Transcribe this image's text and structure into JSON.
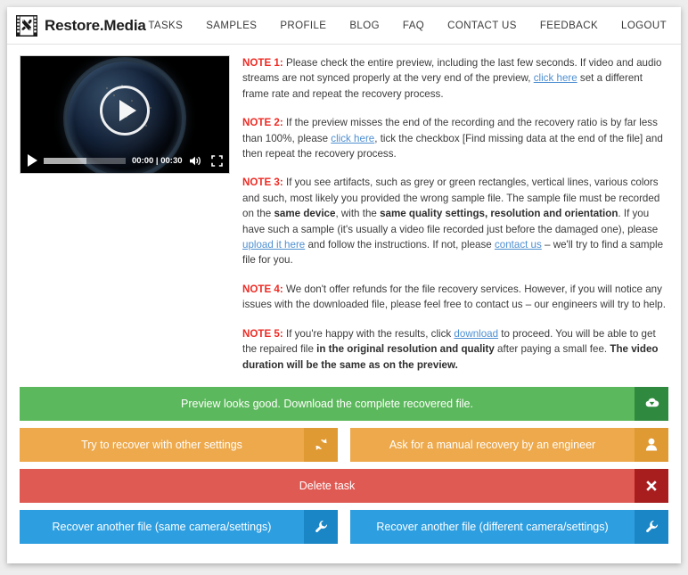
{
  "header": {
    "brand_name": "Restore.Media",
    "brand_icon": "film-strip-tools-icon",
    "nav": [
      {
        "label": "TASKS"
      },
      {
        "label": "SAMPLES"
      },
      {
        "label": "PROFILE"
      },
      {
        "label": "BLOG"
      },
      {
        "label": "FAQ"
      },
      {
        "label": "CONTACT US"
      },
      {
        "label": "FEEDBACK"
      },
      {
        "label": "LOGOUT"
      }
    ]
  },
  "player": {
    "poster_description": "Earth at night from space",
    "current_time": "00:00",
    "separator": "|",
    "duration": "00:30",
    "time_display": "00:00 | 00:30",
    "play_icon": "play-icon",
    "volume_icon": "volume-icon",
    "fullscreen_icon": "fullscreen-icon",
    "progress_percent": 52
  },
  "notes": [
    {
      "label": "NOTE 1:",
      "parts": [
        {
          "type": "text",
          "text": " Please check the entire preview, including the last few seconds. If video and audio streams are not synced properly at the very end of the preview, "
        },
        {
          "type": "link",
          "text": "click here"
        },
        {
          "type": "text",
          "text": " set a different frame rate and repeat the recovery process."
        }
      ]
    },
    {
      "label": "NOTE 2:",
      "parts": [
        {
          "type": "text",
          "text": " If the preview misses the end of the recording and the recovery ratio is by far less than 100%, please "
        },
        {
          "type": "link",
          "text": "click here"
        },
        {
          "type": "text",
          "text": ", tick the checkbox [Find missing data at the end of the file] and then repeat the recovery process."
        }
      ]
    },
    {
      "label": "NOTE 3:",
      "parts": [
        {
          "type": "text",
          "text": " If you see artifacts, such as grey or green rectangles, vertical lines, various colors and such, most likely you provided the wrong sample file. The sample file must be recorded on the "
        },
        {
          "type": "bold",
          "text": "same device"
        },
        {
          "type": "text",
          "text": ", with the "
        },
        {
          "type": "bold",
          "text": "same quality settings, resolution and orientation"
        },
        {
          "type": "text",
          "text": ". If you have such a sample (it's usually a video file recorded just before the damaged one), please "
        },
        {
          "type": "link",
          "text": "upload it here"
        },
        {
          "type": "text",
          "text": " and follow the instructions. If not, please "
        },
        {
          "type": "link",
          "text": "contact us"
        },
        {
          "type": "text",
          "text": " – we'll try to find a sample file for you."
        }
      ]
    },
    {
      "label": "NOTE 4:",
      "parts": [
        {
          "type": "text",
          "text": " We don't offer refunds for the file recovery services. However, if you will notice any issues with the downloaded file, please feel free to contact us – our engineers will try to help."
        }
      ]
    },
    {
      "label": "NOTE 5:",
      "parts": [
        {
          "type": "text",
          "text": " If you're happy with the results, click "
        },
        {
          "type": "link",
          "text": "download"
        },
        {
          "type": "text",
          "text": " to proceed. You will be able to get the repaired file "
        },
        {
          "type": "bold",
          "text": "in the original resolution and quality"
        },
        {
          "type": "text",
          "text": " after paying a small fee. "
        },
        {
          "type": "bold",
          "text": "The video duration will be the same as on the preview."
        }
      ]
    }
  ],
  "actions": {
    "download": {
      "label": "Preview looks good. Download the complete recovered file.",
      "icon": "cloud-download-icon",
      "color": "#5cb85c"
    },
    "retry": {
      "label": "Try to recover with other settings",
      "icon": "refresh-icon",
      "color": "#eda94c"
    },
    "manual": {
      "label": "Ask for a manual recovery by an engineer",
      "icon": "user-icon",
      "color": "#eda94c"
    },
    "delete": {
      "label": "Delete task",
      "icon": "close-x-icon",
      "color": "#e05a54"
    },
    "recover_same": {
      "label": "Recover another file (same camera/settings)",
      "icon": "wrench-icon",
      "color": "#2d9ee0"
    },
    "recover_different": {
      "label": "Recover another file (different camera/settings)",
      "icon": "wrench-icon",
      "color": "#2d9ee0"
    }
  }
}
